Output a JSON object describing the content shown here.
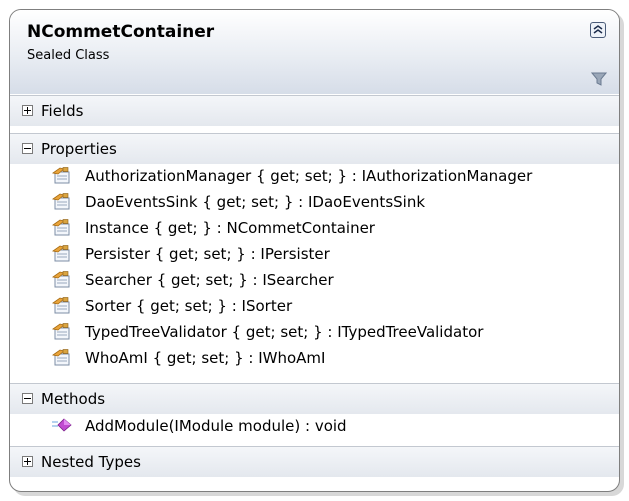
{
  "class_shape": {
    "name": "NCommetContainer",
    "kind": "Sealed Class",
    "collapse_icon": "chevron-up-double-icon",
    "filter_icon": "filter-icon"
  },
  "compartments": {
    "fields": {
      "label": "Fields",
      "expanded": false
    },
    "properties": {
      "label": "Properties",
      "expanded": true,
      "items": [
        "AuthorizationManager { get; set; } : IAuthorizationManager",
        "DaoEventsSink { get; set; } : IDaoEventsSink",
        "Instance { get; } : NCommetContainer",
        "Persister { get; set; } : IPersister",
        "Searcher { get; set; } : ISearcher",
        "Sorter { get; set; } : ISorter",
        "TypedTreeValidator { get; set; } : ITypedTreeValidator",
        "WhoAmI { get; set; } : IWhoAmI"
      ]
    },
    "methods": {
      "label": "Methods",
      "expanded": true,
      "items": [
        "AddModule(IModule module) : void"
      ]
    },
    "nested_types": {
      "label": "Nested Types",
      "expanded": false
    }
  }
}
